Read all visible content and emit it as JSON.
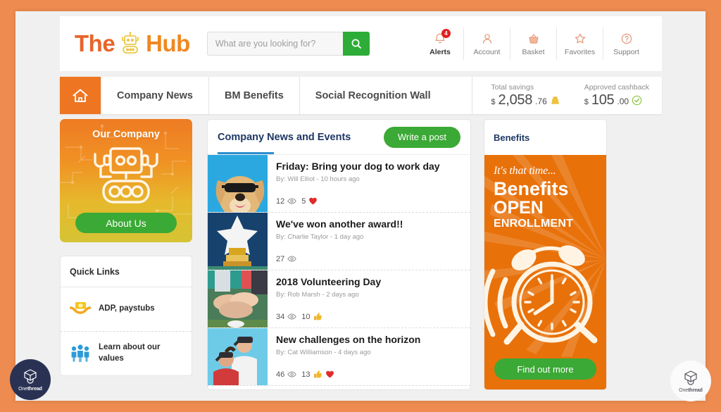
{
  "brand": {
    "logo_the": "The",
    "logo_hub": "Hub",
    "logo_icon": "robot-icon"
  },
  "search": {
    "placeholder": "What are you looking for?",
    "value": "",
    "button_icon": "search-icon"
  },
  "header_nav": [
    {
      "label": "Alerts",
      "icon": "bell-icon",
      "badge": "4",
      "active": true
    },
    {
      "label": "Account",
      "icon": "person-icon",
      "badge": "",
      "active": false
    },
    {
      "label": "Basket",
      "icon": "basket-icon",
      "badge": "",
      "active": false
    },
    {
      "label": "Favorites",
      "icon": "star-icon",
      "badge": "",
      "active": false
    },
    {
      "label": "Support",
      "icon": "question-icon",
      "badge": "",
      "active": false
    }
  ],
  "navbar": {
    "home_icon": "home-icon",
    "tabs": [
      {
        "label": "Company News"
      },
      {
        "label": "BM Benefits"
      },
      {
        "label": "Social Recognition Wall"
      }
    ],
    "stats": [
      {
        "label": "Total savings",
        "currency": "$",
        "integer": "2,058",
        "decimal": ".76",
        "icon": "money-bag-icon"
      },
      {
        "label": "Approved cashback",
        "currency": "$",
        "integer": "105",
        "decimal": ".00",
        "icon": "check-circle-icon"
      }
    ]
  },
  "our_company": {
    "title": "Our Company",
    "illustration": "robot-circuit-illustration",
    "button_label": "About Us"
  },
  "quick_links": {
    "title": "Quick Links",
    "items": [
      {
        "label": "ADP, paystubs",
        "icon": "money-in-hands-icon"
      },
      {
        "label": "Learn about our values",
        "icon": "people-group-icon"
      }
    ]
  },
  "company_news": {
    "title": "Company News and Events",
    "write_post_label": "Write a post",
    "items": [
      {
        "headline": "Friday: Bring your dog to work day",
        "meta": "By: Will Elliot - 10 hours ago",
        "views": "12",
        "reaction_count": "5",
        "reactions": [
          "heart-icon"
        ],
        "thumb": "dog-with-sunglasses-photo"
      },
      {
        "headline": "We've won another award!!",
        "meta": "By: Charlie Taylor - 1 day ago",
        "views": "27",
        "reaction_count": "",
        "reactions": [],
        "thumb": "star-trophy-photo"
      },
      {
        "headline": "2018 Volunteering Day",
        "meta": "By: Rob Marsh - 2 days ago",
        "views": "34",
        "reaction_count": "10",
        "reactions": [
          "thumbs-up-icon"
        ],
        "thumb": "hands-together-photo"
      },
      {
        "headline": "New challenges on the horizon",
        "meta": "By: Cat Williamson - 4 days ago",
        "views": "46",
        "reaction_count": "13",
        "reactions": [
          "thumbs-up-icon",
          "heart-icon"
        ],
        "thumb": "people-with-binoculars-photo"
      }
    ]
  },
  "benefits": {
    "title": "Benefits",
    "banner_line1": "It's that time...",
    "banner_line2": "Benefits",
    "banner_line3": "OPEN",
    "banner_line4": "ENROLLMENT",
    "illustration": "alarm-clock-icon",
    "button_label": "Find out more"
  },
  "watermark": {
    "name_light": "One",
    "name_bold": "thread",
    "icon": "onethread-logo-icon"
  },
  "colors": {
    "frame_border": "#ED8B50",
    "brand_orange": "#E8642A",
    "nav_orange": "#EE7623",
    "green_accent": "#3BA935",
    "search_green": "#2DAD38",
    "badge_red": "#E02020",
    "news_blue": "#1F3864",
    "underline_blue": "#2E8FD0",
    "benefits_orange": "#E8710A"
  }
}
